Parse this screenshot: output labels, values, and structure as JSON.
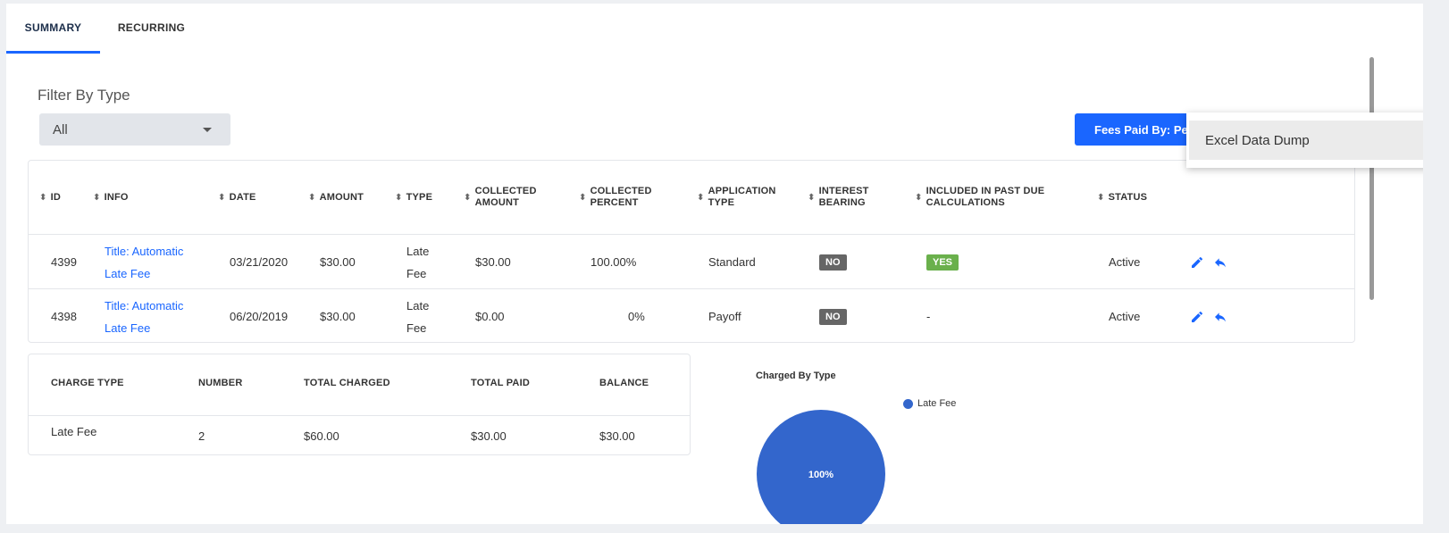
{
  "tabs": [
    {
      "label": "SUMMARY",
      "active": true
    },
    {
      "label": "RECURRING",
      "active": false
    }
  ],
  "filter": {
    "label": "Filter By Type",
    "value": "All"
  },
  "fees_button": {
    "label": "Fees Paid By: Pe"
  },
  "menu": {
    "items": [
      "Excel Data Dump"
    ]
  },
  "table": {
    "headers": {
      "id": "ID",
      "info": "INFO",
      "date": "DATE",
      "amount": "AMOUNT",
      "type": "TYPE",
      "collected_amount": [
        "COLLECTED",
        "AMOUNT"
      ],
      "collected_percent": [
        "COLLECTED",
        "PERCENT"
      ],
      "application_type": [
        "APPLICATION",
        "TYPE"
      ],
      "interest_bearing": [
        "INTEREST",
        "BEARING"
      ],
      "past_due": [
        "INCLUDED IN PAST DUE",
        "CALCULATIONS"
      ],
      "status": "STATUS"
    },
    "rows": [
      {
        "id": "4399",
        "info": [
          "Title: Automatic",
          "Late Fee"
        ],
        "date": "03/21/2020",
        "amount": "$30.00",
        "type": [
          "Late",
          "Fee"
        ],
        "collected_amount": "$30.00",
        "collected_percent": "100.00%",
        "application_type": "Standard",
        "interest_bearing": "NO",
        "past_due": "YES",
        "status": "Active"
      },
      {
        "id": "4398",
        "info": [
          "Title: Automatic",
          "Late Fee"
        ],
        "date": "06/20/2019",
        "amount": "$30.00",
        "type": [
          "Late",
          "Fee"
        ],
        "collected_amount": "$0.00",
        "collected_percent": "0%",
        "application_type": "Payoff",
        "interest_bearing": "NO",
        "past_due": "-",
        "status": "Active"
      }
    ]
  },
  "summary": {
    "headers": {
      "charge_type": "CHARGE TYPE",
      "number": "NUMBER",
      "total_charged": "TOTAL CHARGED",
      "total_paid": "TOTAL PAID",
      "balance": "BALANCE"
    },
    "row": {
      "charge_type": "Late Fee",
      "number": "2",
      "total_charged": "$60.00",
      "total_paid": "$30.00",
      "balance": "$30.00"
    }
  },
  "chart_data": {
    "type": "pie",
    "title": "Charged By Type",
    "categories": [
      "Late Fee"
    ],
    "values": [
      100
    ],
    "labels": [
      "100%"
    ],
    "colors": [
      "#3366cc"
    ],
    "legend": "top-right"
  },
  "colors": {
    "accent": "#1a66ff",
    "yes": "#6ab04c",
    "no": "#666666",
    "pie": "#3366cc"
  }
}
